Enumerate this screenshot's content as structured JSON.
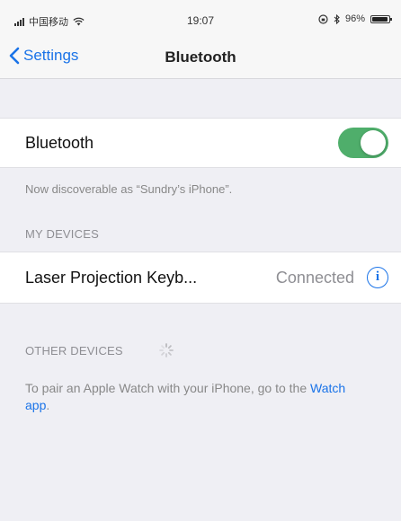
{
  "status_bar": {
    "carrier": "中国移动",
    "time": "19:07",
    "battery_text": "96%",
    "battery_level": 0.96
  },
  "nav": {
    "back_label": "Settings",
    "title": "Bluetooth"
  },
  "bluetooth_row": {
    "label": "Bluetooth",
    "enabled": true,
    "toggle_color": "#4fae6b"
  },
  "discoverable_text": "Now discoverable as “Sundry’s iPhone”.",
  "my_devices": {
    "header": "MY DEVICES",
    "items": [
      {
        "name": "Laser Projection Keyb...",
        "status": "Connected",
        "icon": "info-icon"
      }
    ]
  },
  "other_devices": {
    "header": "OTHER DEVICES",
    "pair_text": "To pair an Apple Watch with your iPhone, go to the ",
    "pair_link": "Watch app",
    "pair_end": "."
  },
  "colors": {
    "accent": "#1a73e8",
    "background": "#efeff4"
  }
}
